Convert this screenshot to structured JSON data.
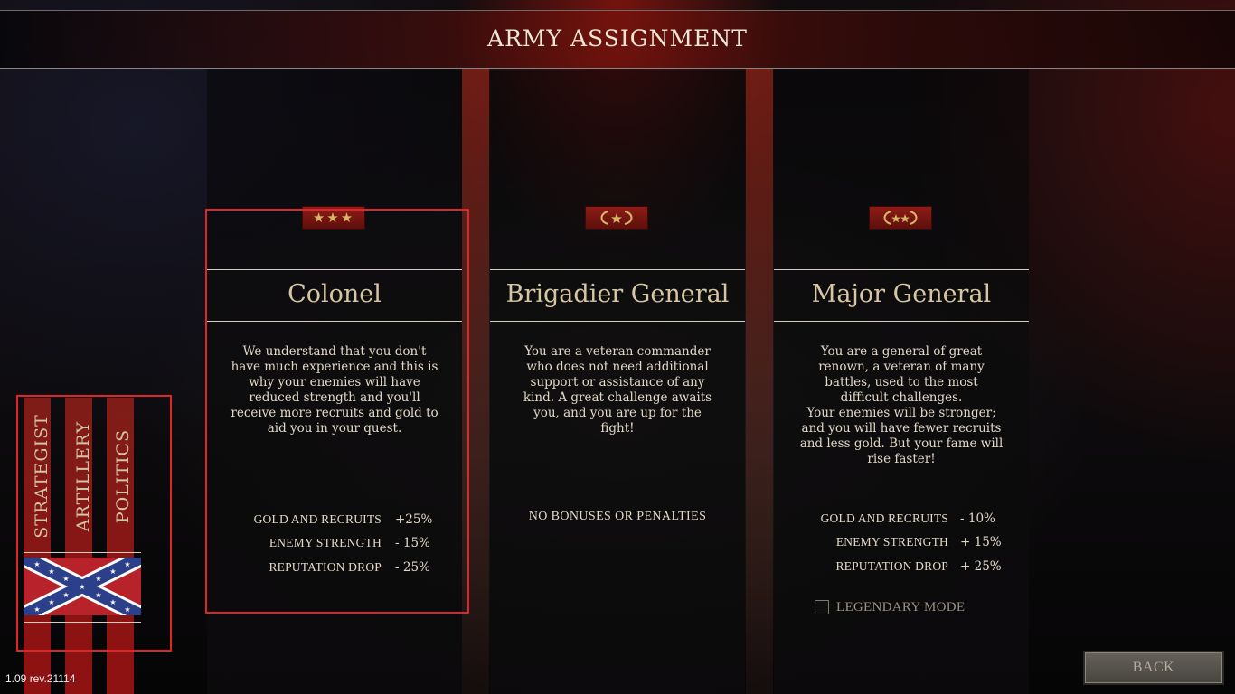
{
  "header": {
    "title": "ARMY ASSIGNMENT"
  },
  "ranks": [
    {
      "title": "Colonel",
      "insignia": "three-stars-icon",
      "insignia_text": "★★★",
      "description": [
        "We understand that you don't",
        "have much experience and this is",
        "why your enemies will have",
        "reduced strength and you'll",
        "receive more recruits and gold to",
        "aid you in your quest."
      ],
      "stats": [
        {
          "label": "GOLD AND RECRUITS",
          "value": "+25%"
        },
        {
          "label": "ENEMY STRENGTH",
          "value": "- 15%"
        },
        {
          "label": "REPUTATION DROP",
          "value": "- 25%"
        }
      ],
      "selected": true
    },
    {
      "title": "Brigadier General",
      "insignia": "wreath-one-star-icon",
      "description": [
        "You are a veteran commander",
        "who does not need additional",
        "support or assistance of any",
        "kind. A great challenge awaits",
        "you, and you are up for the",
        "fight!"
      ],
      "no_bonus_text": "NO BONUSES OR PENALTIES",
      "selected": false
    },
    {
      "title": "Major General",
      "insignia": "wreath-two-stars-icon",
      "description": [
        "You are a general of great",
        "renown, a veteran of many",
        "battles, used to the most",
        "difficult challenges.",
        "Your enemies will be stronger;",
        "and you will have fewer recruits",
        "and less gold. But your fame will",
        "rise faster!"
      ],
      "stats": [
        {
          "label": "GOLD AND RECRUITS",
          "value": "- 10%"
        },
        {
          "label": "ENEMY STRENGTH",
          "value": "+ 15%"
        },
        {
          "label": "REPUTATION DROP",
          "value": "+ 25%"
        }
      ],
      "selected": false
    }
  ],
  "legendary": {
    "label": "LEGENDARY MODE",
    "checked": false
  },
  "sidebar": {
    "tabs": [
      "STRATEGIST",
      "ARTILLERY",
      "POLITICS"
    ],
    "flag": "confederate-battle-flag-icon"
  },
  "back_button": {
    "label": "BACK"
  },
  "version": "1.09 rev.21114",
  "colors": {
    "accent_red": "#8e1c16",
    "highlight": "#e1232a",
    "gold": "#d8b466"
  }
}
